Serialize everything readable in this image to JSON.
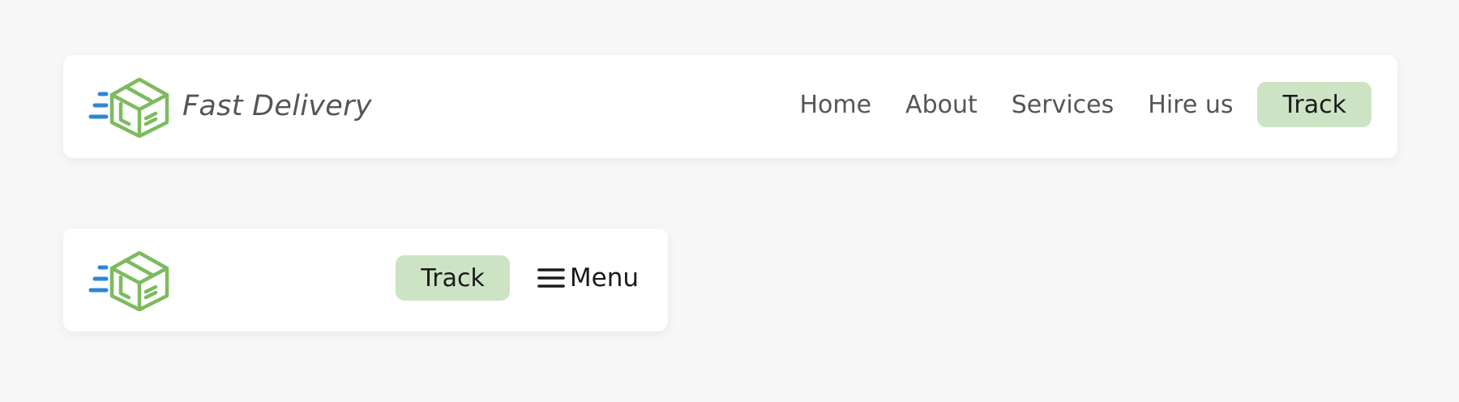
{
  "desktop_nav": {
    "brand": "Fast Delivery",
    "links": [
      "Home",
      "About",
      "Services",
      "Hire us"
    ],
    "track_label": "Track"
  },
  "mobile_nav": {
    "track_label": "Track",
    "menu_label": "Menu"
  },
  "icons": {
    "logo": "delivery-box-icon",
    "menu": "hamburger-icon"
  },
  "colors": {
    "logo_box": "#7cbb5e",
    "logo_speed_lines": "#2e86d6",
    "track_button": "#cce4c4",
    "page_background": "#f7f7f7"
  }
}
